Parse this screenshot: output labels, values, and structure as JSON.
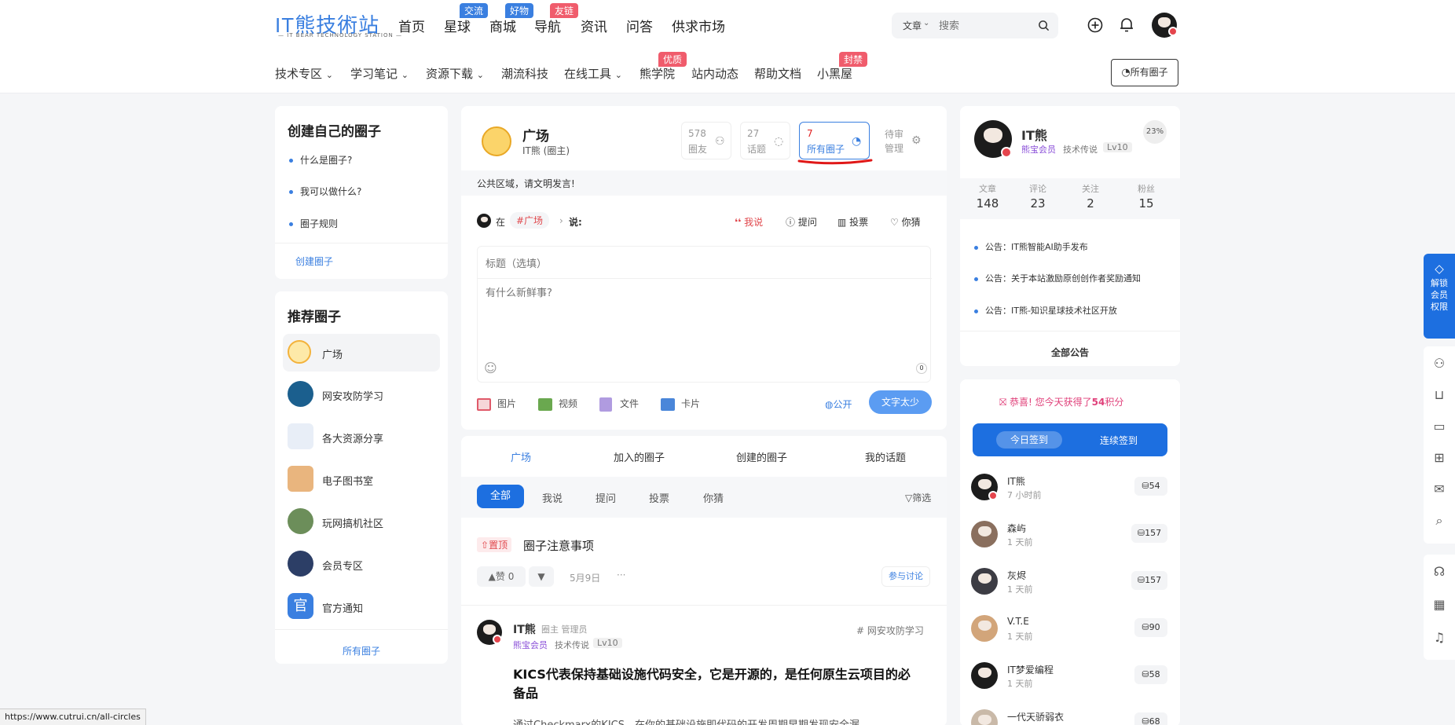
{
  "header": {
    "logo": "IT熊技術站",
    "logo_sub": "— IT BEAR TECHNOLOGY STATION —",
    "nav": [
      {
        "label": "首页",
        "badge": ""
      },
      {
        "label": "星球",
        "badge": "交流"
      },
      {
        "label": "商城",
        "badge": "好物"
      },
      {
        "label": "导航",
        "badge": "友链"
      },
      {
        "label": "资讯",
        "badge": ""
      },
      {
        "label": "问答",
        "badge": ""
      },
      {
        "label": "供求市场",
        "badge": ""
      }
    ],
    "search": {
      "category": "文章",
      "placeholder": "搜索"
    },
    "subnav": [
      {
        "label": "技术专区",
        "badge": ""
      },
      {
        "label": "学习笔记",
        "badge": ""
      },
      {
        "label": "资源下载",
        "badge": ""
      },
      {
        "label": "潮流科技",
        "badge": ""
      },
      {
        "label": "在线工具",
        "badge": ""
      },
      {
        "label": "熊学院",
        "badge": "优质"
      },
      {
        "label": "站内动态",
        "badge": ""
      },
      {
        "label": "帮助文档",
        "badge": ""
      },
      {
        "label": "小黑屋",
        "badge": "封禁"
      }
    ],
    "all_circles_btn": "所有圈子",
    "colors": {
      "brand": "#3a7fe0",
      "badge_blue": "#3a7fe0",
      "badge_red": "#f05c6c"
    }
  },
  "left": {
    "create_title": "创建自己的圈子",
    "create_items": [
      "什么是圈子?",
      "我可以做什么?",
      "圈子规则"
    ],
    "create_link": "创建圈子",
    "rec_title": "推荐圈子",
    "rec_items": [
      "广场",
      "网安攻防学习",
      "各大资源分享",
      "电子图书室",
      "玩网搞机社区",
      "会员专区",
      "官方通知"
    ],
    "all_link": "所有圈子"
  },
  "circle": {
    "name": "广场",
    "owner": "IT熊 (圈主)",
    "stats": [
      {
        "value": "578",
        "label": "圈友"
      },
      {
        "value": "27",
        "label": "话题"
      },
      {
        "value": "7",
        "label": "所有圈子"
      },
      {
        "value": "待审",
        "label": "管理"
      }
    ],
    "notice": "公共区域，请文明发言!",
    "post_in": "在",
    "post_tag": "#广场",
    "post_say": "说:",
    "types": [
      "我说",
      "提问",
      "投票",
      "你猜"
    ],
    "title_placeholder": "标题（选填）",
    "body_placeholder": "有什么新鲜事?",
    "char_count": "0",
    "media": [
      "图片",
      "视频",
      "文件",
      "卡片"
    ],
    "visibility": "公开",
    "submit": "文字太少"
  },
  "feed": {
    "tabs": [
      "广场",
      "加入的圈子",
      "创建的圈子",
      "我的话题"
    ],
    "filters": [
      "全部",
      "我说",
      "提问",
      "投票",
      "你猜"
    ],
    "filter_btn": "筛选",
    "pinned": {
      "tag": "置顶",
      "title": "圈子注意事项",
      "likes": "赞 0",
      "date": "5月9日",
      "more": "···",
      "join": "参与讨论"
    },
    "post": {
      "author": "IT熊",
      "roles": "圈主  管理员",
      "vip": "熊宝会员",
      "title_tag": "技术传说",
      "level": "Lv10",
      "circle": "# 网安攻防学习",
      "headline": "KICS代表保持基础设施代码安全，它是开源的，是任何原生云项目的必备品",
      "excerpt": "通过Checkmarx的KICS，在你的基础设施即代码的开发周期早期发现安全漏"
    }
  },
  "profile": {
    "name": "IT熊",
    "vip": "熊宝会员",
    "title": "技术传说",
    "level": "Lv10",
    "percent": "23%",
    "stats": [
      {
        "label": "文章",
        "value": "148"
      },
      {
        "label": "评论",
        "value": "23"
      },
      {
        "label": "关注",
        "value": "2"
      },
      {
        "label": "粉丝",
        "value": "15"
      }
    ],
    "notices": [
      "公告：IT熊智能AI助手发布",
      "公告：关于本站激励原创创作者奖励通知",
      "公告：IT熊-知识星球技术社区开放"
    ],
    "all_notices": "全部公告"
  },
  "checkin": {
    "msg_pre": "恭喜! 您今天获得了",
    "msg_num": "54",
    "msg_post": "积分",
    "today": "今日签到",
    "streak": "连续签到",
    "users": [
      {
        "name": "IT熊",
        "time": "7 小时前",
        "points": "54"
      },
      {
        "name": "森屿",
        "time": "1 天前",
        "points": "157"
      },
      {
        "name": "灰烬",
        "time": "1 天前",
        "points": "157"
      },
      {
        "name": "V.T.E",
        "time": "1 天前",
        "points": "90"
      },
      {
        "name": "IT梦爱编程",
        "time": "1 天前",
        "points": "58"
      },
      {
        "name": "一代天骄弱衣",
        "time": "",
        "points": "68"
      }
    ]
  },
  "float": {
    "vip_label": "解锁会员权限"
  },
  "status_url": "https://www.cutrui.cn/all-circles"
}
